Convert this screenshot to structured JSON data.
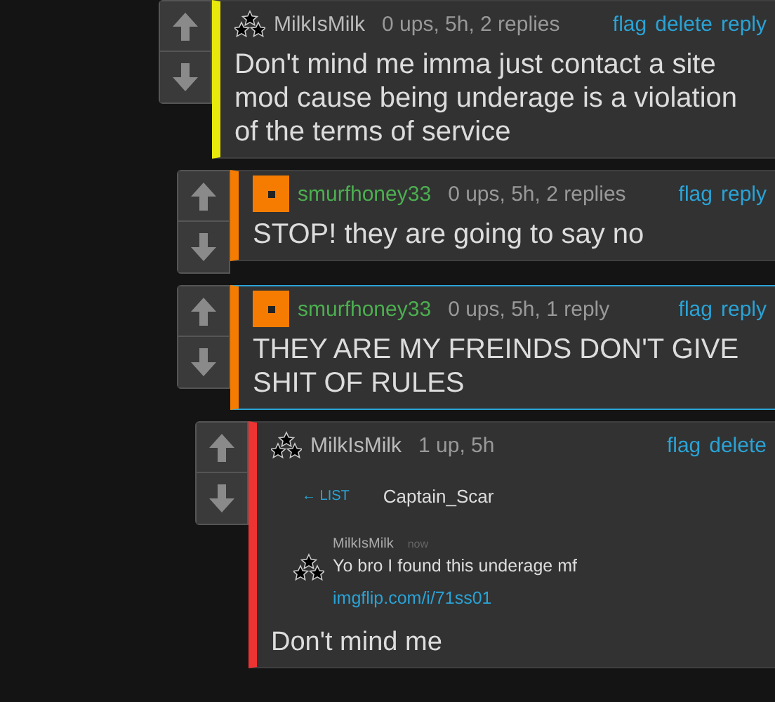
{
  "comments": [
    {
      "kind": "stars",
      "user": "MilkIsMilk",
      "meta": "0 ups, 5h, 2 replies",
      "actions": [
        "flag",
        "delete",
        "reply"
      ],
      "color": "#e8e80c",
      "highlighted": false,
      "text": "Don't mind me imma just contact a site mod cause being underage is a violation of the terms of service",
      "children": [
        {
          "kind": "square",
          "user": "smurfhoney33",
          "meta": "0 ups, 5h, 2 replies",
          "actions": [
            "flag",
            "reply"
          ],
          "color": "#f57c00",
          "highlighted": false,
          "text": "STOP! they are going to say no"
        },
        {
          "kind": "square",
          "user": "smurfhoney33",
          "meta": "0 ups, 5h, 1 reply",
          "actions": [
            "flag",
            "reply"
          ],
          "color": "#f57c00",
          "highlighted": true,
          "text": "THEY ARE MY FREINDS DON'T GIVE SHIT OF RULES",
          "children": [
            {
              "kind": "stars",
              "user": "MilkIsMilk",
              "meta": "1 up, 5h",
              "actions": [
                "flag",
                "delete"
              ],
              "color": "#ee3333",
              "highlighted": false,
              "attachment": {
                "back_link": "← LIST",
                "chat_title": "Captain_Scar",
                "message": {
                  "user": "MilkIsMilk",
                  "time": "now",
                  "text": "Yo bro I found this underage mf",
                  "link": "imgflip.com/i/71ss01"
                },
                "caption": "Don't mind me"
              }
            }
          ]
        }
      ]
    }
  ]
}
